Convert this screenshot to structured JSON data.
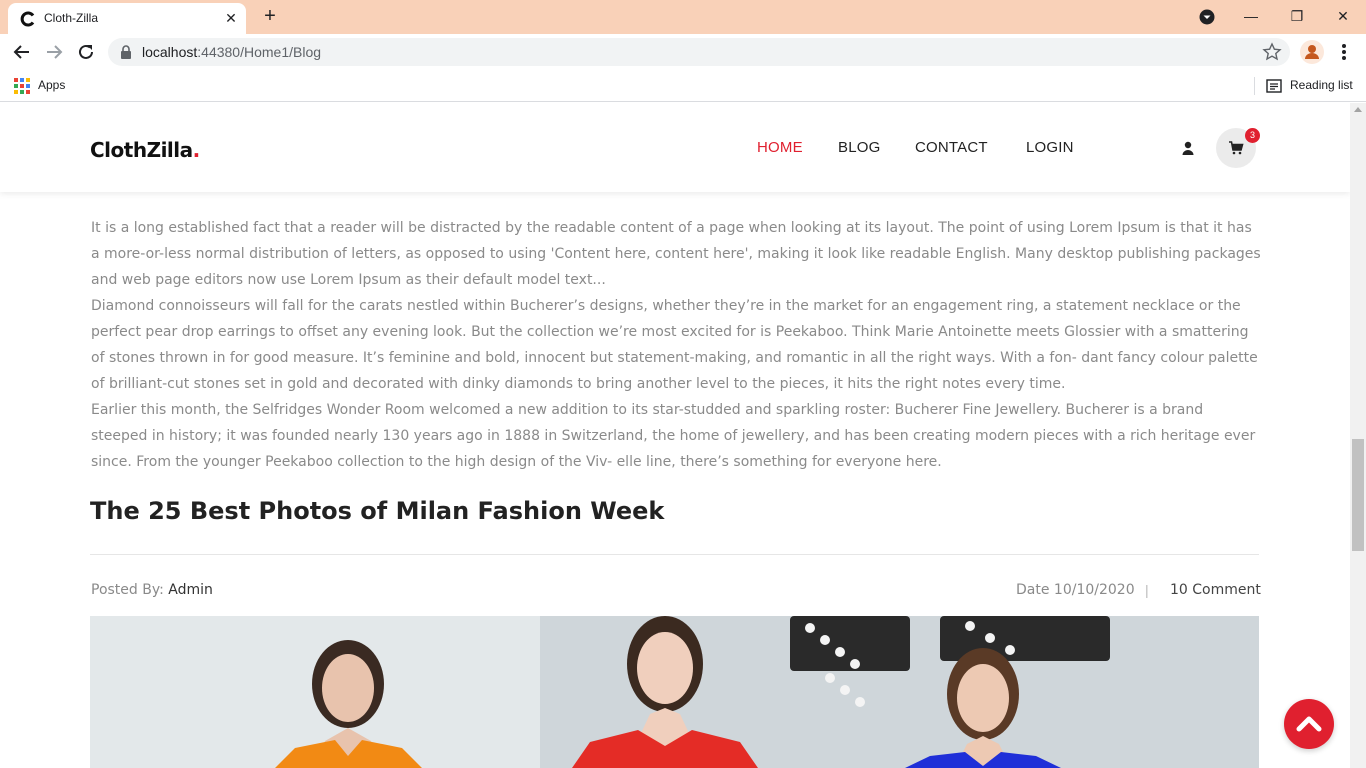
{
  "browser": {
    "tab_title": "Cloth-Zilla",
    "url_host": "localhost",
    "url_path": ":44380/Home1/Blog",
    "bookmarks_apps": "Apps",
    "reading_list": "Reading list"
  },
  "header": {
    "logo_main": "ClothZilla",
    "logo_dot": ".",
    "nav": [
      "HOME",
      "BLOG",
      "CONTACT",
      "LOGIN"
    ],
    "active_nav": "HOME",
    "cart_count": "3"
  },
  "article": {
    "paragraphs": [
      "It is a long established fact that a reader will be distracted by the readable content of a page when looking at its layout. The point of using Lorem Ipsum is that it has a more-or-less normal distribution of letters, as opposed to using 'Content here, content here', making it look like readable English. Many desktop publishing packages and web page editors now use Lorem Ipsum as their default model text...",
      "Diamond connoisseurs will fall for the carats nestled within Bucherer’s designs, whether they’re in the market for an engagement ring, a statement necklace or the perfect pear drop earrings to offset any evening look. But the collection we’re most excited for is Peekaboo. Think Marie Antoinette meets Glossier with a smattering of stones thrown in for good measure. It’s feminine and bold, innocent but statement-making, and romantic in all the right ways. With a fon- dant fancy colour palette of brilliant-cut stones set in gold and decorated with dinky diamonds to bring another level to the pieces, it hits the right notes every time.",
      "Earlier this month, the Selfridges Wonder Room welcomed a new addition to its star-studded and sparkling roster: Bucherer Fine Jewellery. Bucherer is a brand steeped in history; it was founded nearly 130 years ago in 1888 in Switzerland, the home of jewellery, and has been creating modern pieces with a rich heritage ever since. From the younger Peekaboo collection to the high design of the Viv- elle line, there’s something for everyone here."
    ]
  },
  "post": {
    "title": "The 25 Best Photos of Milan Fashion Week",
    "posted_by_label": "Posted By:",
    "author": "Admin",
    "date": "Date 10/10/2020",
    "separator": "|",
    "comments": "10 Comment"
  },
  "colors": {
    "accent": "#e0202f",
    "tab_bar": "#f9d1b8"
  }
}
